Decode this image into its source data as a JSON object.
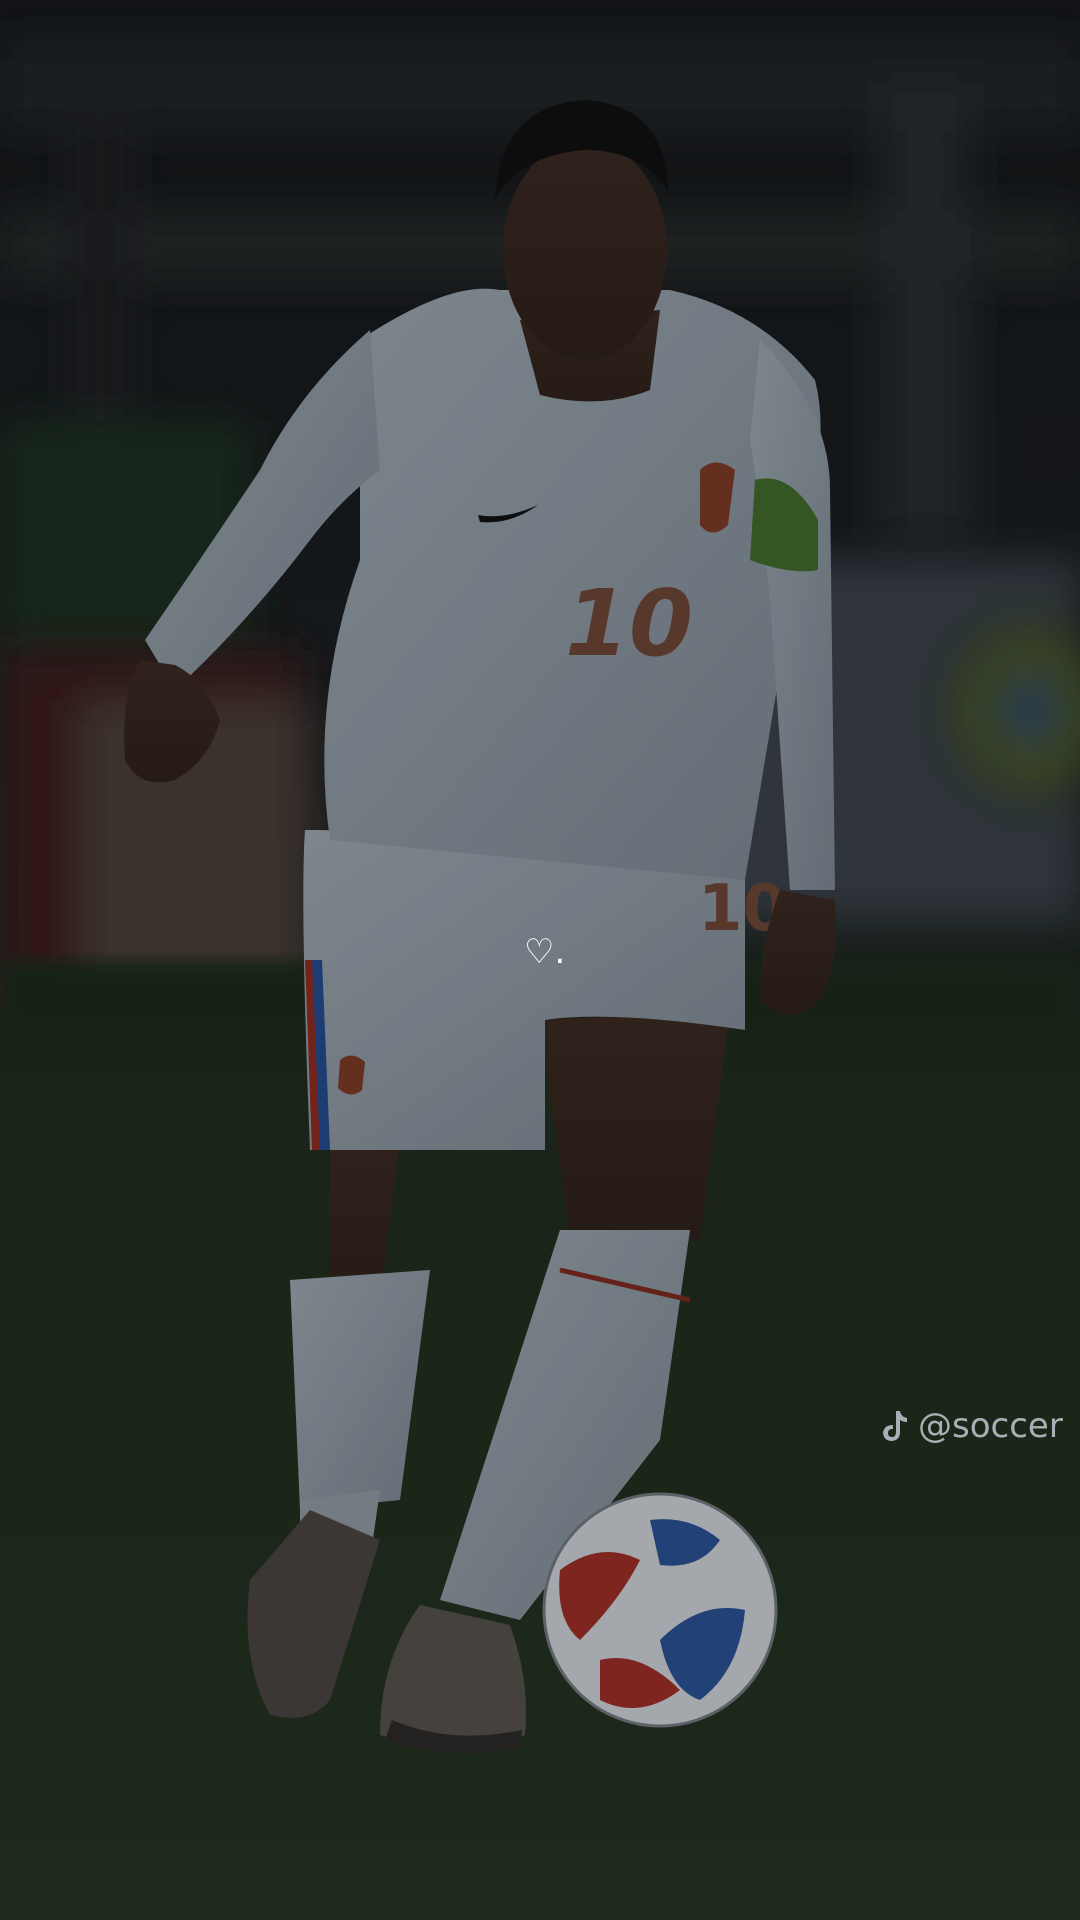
{
  "scene": {
    "description_alt": "",
    "colors": {
      "background_top": "#15191d",
      "pitch": "#1f2a1c",
      "kit": "#8f9aa3",
      "accent_red": "#8c2c22",
      "accent_blue": "#244a8c",
      "armband_green": "#3f6a2a"
    }
  },
  "overlay": {
    "caption": "♡."
  },
  "watermark": {
    "icon": "tiktok-icon",
    "handle": "@soccer"
  }
}
